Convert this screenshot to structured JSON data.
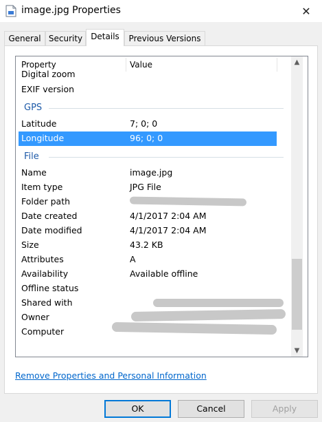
{
  "window": {
    "title": "image.jpg Properties",
    "close_glyph": "✕"
  },
  "tabs": [
    {
      "label": "General"
    },
    {
      "label": "Security"
    },
    {
      "label": "Details"
    },
    {
      "label": "Previous Versions"
    }
  ],
  "list": {
    "header": {
      "property": "Property",
      "value": "Value"
    },
    "cut_row": "Digital zoom",
    "rows_top": [
      {
        "name": "EXIF version",
        "value": ""
      }
    ],
    "groups": {
      "gps": "GPS",
      "file": "File"
    },
    "gps_rows": [
      {
        "name": "Latitude",
        "value": "7; 0; 0"
      },
      {
        "name": "Longitude",
        "value": "96; 0; 0"
      }
    ],
    "file_rows": [
      {
        "name": "Name",
        "value": "image.jpg"
      },
      {
        "name": "Item type",
        "value": "JPG File"
      },
      {
        "name": "Folder path",
        "value": ""
      },
      {
        "name": "Date created",
        "value": "4/1/2017 2:04 AM"
      },
      {
        "name": "Date modified",
        "value": "4/1/2017 2:04 AM"
      },
      {
        "name": "Size",
        "value": "43.2 KB"
      },
      {
        "name": "Attributes",
        "value": "A"
      },
      {
        "name": "Availability",
        "value": "Available offline"
      },
      {
        "name": "Offline status",
        "value": ""
      },
      {
        "name": "Shared with",
        "value": ""
      },
      {
        "name": "Owner",
        "value": ""
      },
      {
        "name": "Computer",
        "value": ""
      }
    ],
    "scroll_up_glyph": "▲",
    "scroll_down_glyph": "▼"
  },
  "link_text": "Remove Properties and Personal Information",
  "buttons": {
    "ok": "OK",
    "cancel": "Cancel",
    "apply": "Apply"
  },
  "colors": {
    "selection": "#3399ff",
    "group_header": "#1e5aa8",
    "link": "#0066cc",
    "redaction": "#c8c8c8"
  }
}
